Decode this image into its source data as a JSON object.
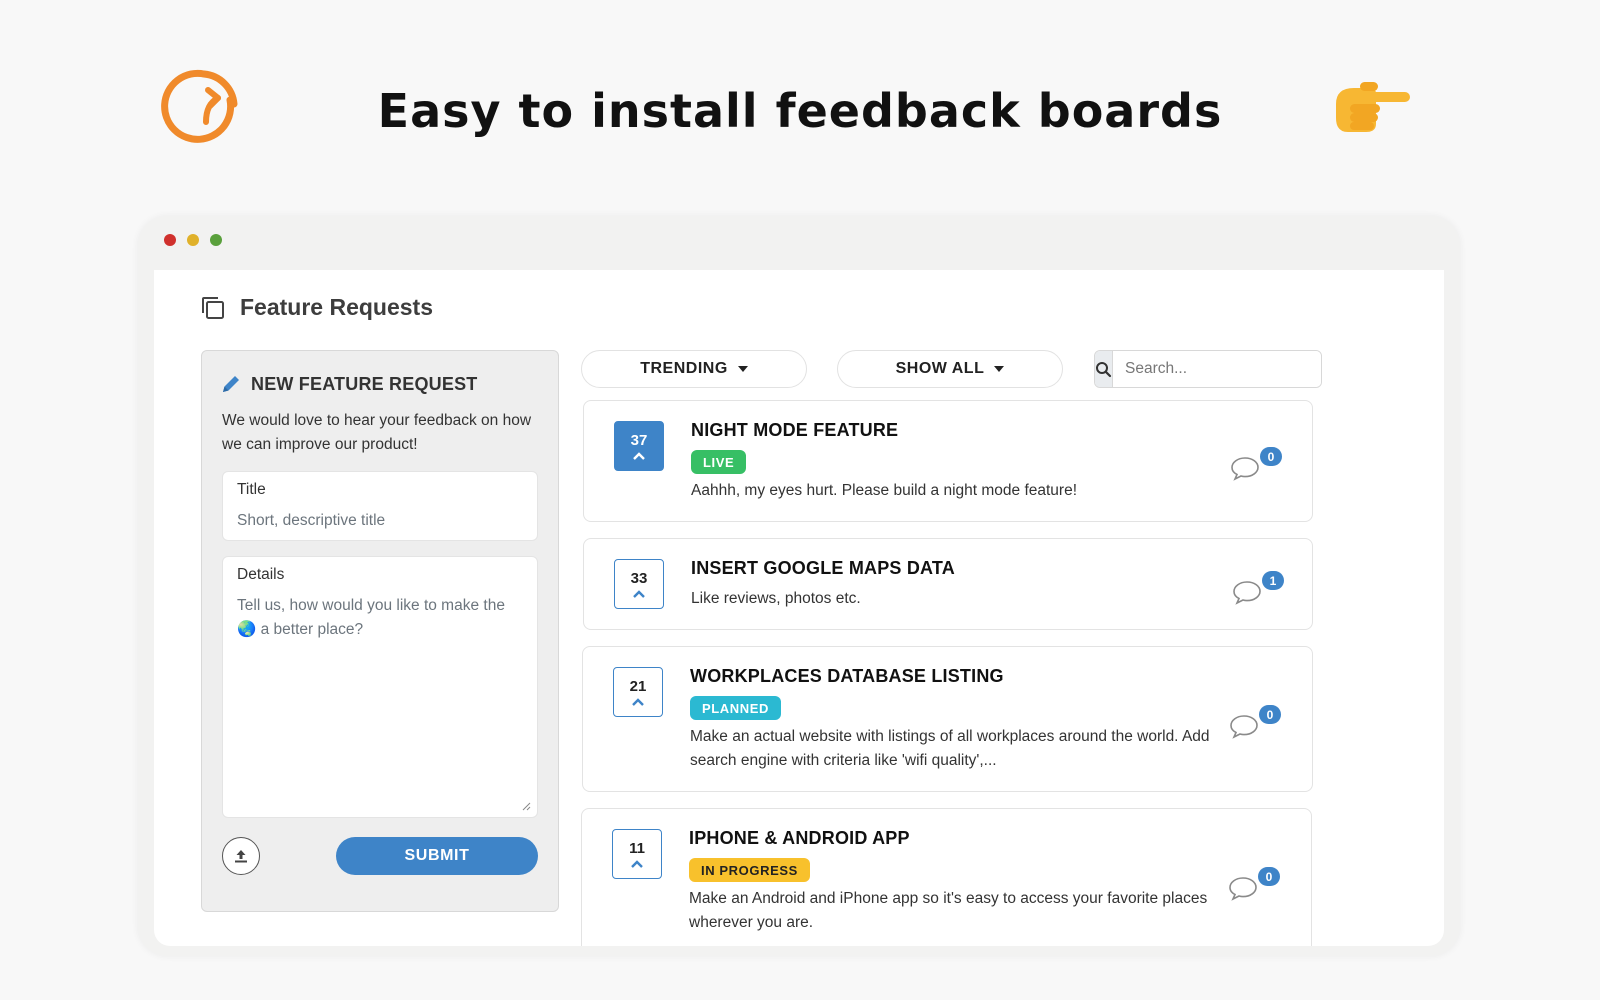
{
  "hero": {
    "title": "Easy to install feedback boards",
    "logo_icon": "circular-arrow-logo-icon",
    "hand_icon": "pointing-hand-icon",
    "brand_color": "#f08a2b"
  },
  "window": {
    "controls": [
      "close",
      "minimize",
      "maximize"
    ],
    "control_colors": [
      "#d0312d",
      "#e0b12a",
      "#5aa03c"
    ]
  },
  "page": {
    "title": "Feature Requests",
    "title_icon": "copy-icon"
  },
  "new_request": {
    "heading": "NEW FEATURE REQUEST",
    "heading_icon": "pencil-icon",
    "description": "We would love to hear your feedback on how we can improve our product!",
    "title_label": "Title",
    "title_placeholder": "Short, descriptive title",
    "details_label": "Details",
    "details_placeholder": "Tell us, how would you like to make the 🌏 a better place?",
    "upload_icon": "upload-icon",
    "submit_label": "SUBMIT"
  },
  "filters": {
    "sort_label": "TRENDING",
    "status_label": "SHOW ALL",
    "search_placeholder": "Search...",
    "search_icon": "search-icon"
  },
  "requests": [
    {
      "votes": "37",
      "voted": true,
      "title": "NIGHT MODE FEATURE",
      "status": "LIVE",
      "description": "Aahhh, my eyes hurt. Please build a night mode feature!",
      "comments": "0"
    },
    {
      "votes": "33",
      "voted": false,
      "title": "INSERT GOOGLE MAPS DATA",
      "status": "",
      "description": "Like reviews, photos etc.",
      "comments": "1"
    },
    {
      "votes": "21",
      "voted": false,
      "title": "WORKPLACES DATABASE LISTING",
      "status": "PLANNED",
      "description": "Make an actual website with listings of all workplaces around the world. Add search engine with criteria like 'wifi quality',...",
      "comments": "0"
    },
    {
      "votes": "11",
      "voted": false,
      "title": "IPHONE & ANDROID APP",
      "status": "IN PROGRESS",
      "description": "Make an Android and iPhone app so it's easy to access your favorite places wherever you are.",
      "comments": "0"
    }
  ],
  "colors": {
    "primary": "#3e84c8",
    "live": "#37bf65",
    "planned": "#2bb9d2",
    "in_progress": "#f8c12c"
  }
}
